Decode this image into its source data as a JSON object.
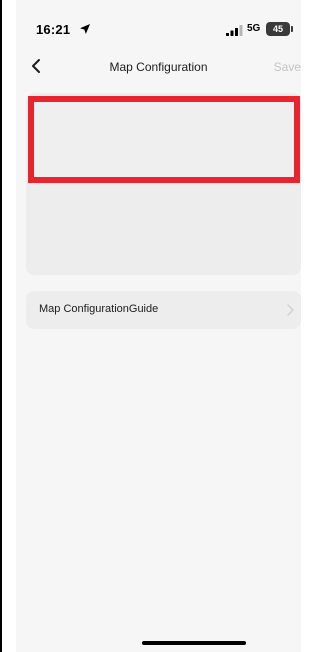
{
  "status_bar": {
    "time": "16:21",
    "network": "5G",
    "battery": "45"
  },
  "nav": {
    "title": "Map Configuration",
    "save_label": "Save"
  },
  "guide": {
    "label": "Map ConfigurationGuide"
  },
  "colors": {
    "highlight": "#e8252e",
    "background": "#f6f6f6",
    "card": "#ededed",
    "disabled_text": "#c4c4c4"
  },
  "icons": {
    "back": "chevron-left-icon",
    "location": "location-arrow-icon",
    "signal": "signal-bars-icon",
    "battery": "battery-icon",
    "row_chevron": "chevron-right-icon"
  }
}
